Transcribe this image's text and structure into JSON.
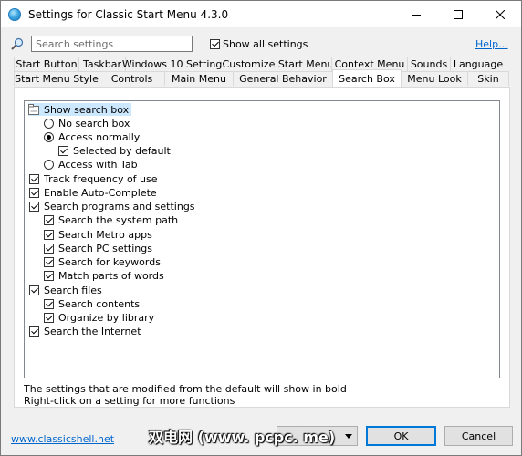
{
  "window": {
    "title": "Settings for Classic Start Menu 4.3.0"
  },
  "toolbar": {
    "search_placeholder": "Search settings",
    "show_all_label": "Show all settings",
    "show_all_checked": true,
    "help_label": "Help..."
  },
  "tabs": {
    "row1": [
      "Start Button",
      "Taskbar",
      "Windows 10 Settings",
      "Customize Start Menu",
      "Context Menu",
      "Sounds",
      "Language"
    ],
    "row2": [
      "Start Menu Style",
      "Controls",
      "Main Menu",
      "General Behavior",
      "Search Box",
      "Menu Look",
      "Skin"
    ],
    "active": "Search Box"
  },
  "tree": {
    "items": [
      {
        "label": "Show search box",
        "control": "folder",
        "checked": true
      },
      {
        "label": "No search box",
        "control": "radio",
        "checked": false
      },
      {
        "label": "Access normally",
        "control": "radio",
        "checked": true
      },
      {
        "label": "Selected by default",
        "control": "checkbox",
        "checked": true
      },
      {
        "label": "Access with Tab",
        "control": "radio",
        "checked": false
      },
      {
        "label": "Track frequency of use",
        "control": "checkbox",
        "checked": true
      },
      {
        "label": "Enable Auto-Complete",
        "control": "checkbox",
        "checked": true
      },
      {
        "label": "Search programs and settings",
        "control": "checkbox",
        "checked": true
      },
      {
        "label": "Search the system path",
        "control": "checkbox",
        "checked": true
      },
      {
        "label": "Search Metro apps",
        "control": "checkbox",
        "checked": true
      },
      {
        "label": "Search PC settings",
        "control": "checkbox",
        "checked": true
      },
      {
        "label": "Search for keywords",
        "control": "checkbox",
        "checked": true
      },
      {
        "label": "Match parts of words",
        "control": "checkbox",
        "checked": true
      },
      {
        "label": "Search files",
        "control": "checkbox",
        "checked": true
      },
      {
        "label": "Search contents",
        "control": "checkbox",
        "checked": true
      },
      {
        "label": "Organize by library",
        "control": "checkbox",
        "checked": true
      },
      {
        "label": "Search the Internet",
        "control": "checkbox",
        "checked": true
      }
    ]
  },
  "info": {
    "line1": "The settings that are modified from the default will show in bold",
    "line2": "Right-click on a setting for more functions"
  },
  "bottom": {
    "website_link": "www.classicshell.net",
    "backup_label": "Backup",
    "ok_label": "OK",
    "cancel_label": "Cancel"
  },
  "watermark": "双电网 (www. pcpc. me)"
}
